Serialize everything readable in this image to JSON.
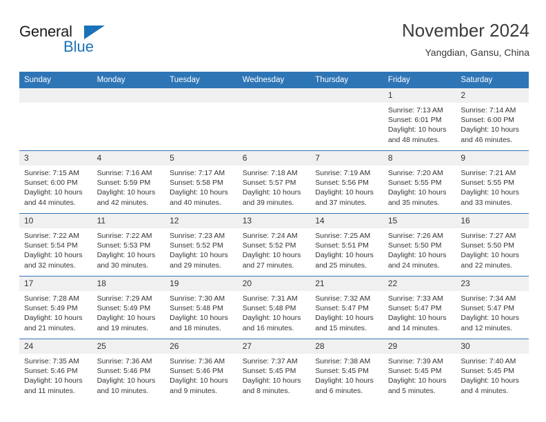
{
  "brand": {
    "name_top": "General",
    "name_bottom": "Blue",
    "accent_color": "#1b72b8"
  },
  "header": {
    "month_title": "November 2024",
    "location": "Yangdian, Gansu, China"
  },
  "theme": {
    "header_bg": "#2e75b6",
    "daynum_bg": "#f0f0f0",
    "text_color": "#333333"
  },
  "weekday_headers": [
    "Sunday",
    "Monday",
    "Tuesday",
    "Wednesday",
    "Thursday",
    "Friday",
    "Saturday"
  ],
  "weeks": [
    [
      {
        "day": "",
        "empty": true
      },
      {
        "day": "",
        "empty": true
      },
      {
        "day": "",
        "empty": true
      },
      {
        "day": "",
        "empty": true
      },
      {
        "day": "",
        "empty": true
      },
      {
        "day": "1",
        "sunrise": "Sunrise: 7:13 AM",
        "sunset": "Sunset: 6:01 PM",
        "daylight": "Daylight: 10 hours and 48 minutes."
      },
      {
        "day": "2",
        "sunrise": "Sunrise: 7:14 AM",
        "sunset": "Sunset: 6:00 PM",
        "daylight": "Daylight: 10 hours and 46 minutes."
      }
    ],
    [
      {
        "day": "3",
        "sunrise": "Sunrise: 7:15 AM",
        "sunset": "Sunset: 6:00 PM",
        "daylight": "Daylight: 10 hours and 44 minutes."
      },
      {
        "day": "4",
        "sunrise": "Sunrise: 7:16 AM",
        "sunset": "Sunset: 5:59 PM",
        "daylight": "Daylight: 10 hours and 42 minutes."
      },
      {
        "day": "5",
        "sunrise": "Sunrise: 7:17 AM",
        "sunset": "Sunset: 5:58 PM",
        "daylight": "Daylight: 10 hours and 40 minutes."
      },
      {
        "day": "6",
        "sunrise": "Sunrise: 7:18 AM",
        "sunset": "Sunset: 5:57 PM",
        "daylight": "Daylight: 10 hours and 39 minutes."
      },
      {
        "day": "7",
        "sunrise": "Sunrise: 7:19 AM",
        "sunset": "Sunset: 5:56 PM",
        "daylight": "Daylight: 10 hours and 37 minutes."
      },
      {
        "day": "8",
        "sunrise": "Sunrise: 7:20 AM",
        "sunset": "Sunset: 5:55 PM",
        "daylight": "Daylight: 10 hours and 35 minutes."
      },
      {
        "day": "9",
        "sunrise": "Sunrise: 7:21 AM",
        "sunset": "Sunset: 5:55 PM",
        "daylight": "Daylight: 10 hours and 33 minutes."
      }
    ],
    [
      {
        "day": "10",
        "sunrise": "Sunrise: 7:22 AM",
        "sunset": "Sunset: 5:54 PM",
        "daylight": "Daylight: 10 hours and 32 minutes."
      },
      {
        "day": "11",
        "sunrise": "Sunrise: 7:22 AM",
        "sunset": "Sunset: 5:53 PM",
        "daylight": "Daylight: 10 hours and 30 minutes."
      },
      {
        "day": "12",
        "sunrise": "Sunrise: 7:23 AM",
        "sunset": "Sunset: 5:52 PM",
        "daylight": "Daylight: 10 hours and 29 minutes."
      },
      {
        "day": "13",
        "sunrise": "Sunrise: 7:24 AM",
        "sunset": "Sunset: 5:52 PM",
        "daylight": "Daylight: 10 hours and 27 minutes."
      },
      {
        "day": "14",
        "sunrise": "Sunrise: 7:25 AM",
        "sunset": "Sunset: 5:51 PM",
        "daylight": "Daylight: 10 hours and 25 minutes."
      },
      {
        "day": "15",
        "sunrise": "Sunrise: 7:26 AM",
        "sunset": "Sunset: 5:50 PM",
        "daylight": "Daylight: 10 hours and 24 minutes."
      },
      {
        "day": "16",
        "sunrise": "Sunrise: 7:27 AM",
        "sunset": "Sunset: 5:50 PM",
        "daylight": "Daylight: 10 hours and 22 minutes."
      }
    ],
    [
      {
        "day": "17",
        "sunrise": "Sunrise: 7:28 AM",
        "sunset": "Sunset: 5:49 PM",
        "daylight": "Daylight: 10 hours and 21 minutes."
      },
      {
        "day": "18",
        "sunrise": "Sunrise: 7:29 AM",
        "sunset": "Sunset: 5:49 PM",
        "daylight": "Daylight: 10 hours and 19 minutes."
      },
      {
        "day": "19",
        "sunrise": "Sunrise: 7:30 AM",
        "sunset": "Sunset: 5:48 PM",
        "daylight": "Daylight: 10 hours and 18 minutes."
      },
      {
        "day": "20",
        "sunrise": "Sunrise: 7:31 AM",
        "sunset": "Sunset: 5:48 PM",
        "daylight": "Daylight: 10 hours and 16 minutes."
      },
      {
        "day": "21",
        "sunrise": "Sunrise: 7:32 AM",
        "sunset": "Sunset: 5:47 PM",
        "daylight": "Daylight: 10 hours and 15 minutes."
      },
      {
        "day": "22",
        "sunrise": "Sunrise: 7:33 AM",
        "sunset": "Sunset: 5:47 PM",
        "daylight": "Daylight: 10 hours and 14 minutes."
      },
      {
        "day": "23",
        "sunrise": "Sunrise: 7:34 AM",
        "sunset": "Sunset: 5:47 PM",
        "daylight": "Daylight: 10 hours and 12 minutes."
      }
    ],
    [
      {
        "day": "24",
        "sunrise": "Sunrise: 7:35 AM",
        "sunset": "Sunset: 5:46 PM",
        "daylight": "Daylight: 10 hours and 11 minutes."
      },
      {
        "day": "25",
        "sunrise": "Sunrise: 7:36 AM",
        "sunset": "Sunset: 5:46 PM",
        "daylight": "Daylight: 10 hours and 10 minutes."
      },
      {
        "day": "26",
        "sunrise": "Sunrise: 7:36 AM",
        "sunset": "Sunset: 5:46 PM",
        "daylight": "Daylight: 10 hours and 9 minutes."
      },
      {
        "day": "27",
        "sunrise": "Sunrise: 7:37 AM",
        "sunset": "Sunset: 5:45 PM",
        "daylight": "Daylight: 10 hours and 8 minutes."
      },
      {
        "day": "28",
        "sunrise": "Sunrise: 7:38 AM",
        "sunset": "Sunset: 5:45 PM",
        "daylight": "Daylight: 10 hours and 6 minutes."
      },
      {
        "day": "29",
        "sunrise": "Sunrise: 7:39 AM",
        "sunset": "Sunset: 5:45 PM",
        "daylight": "Daylight: 10 hours and 5 minutes."
      },
      {
        "day": "30",
        "sunrise": "Sunrise: 7:40 AM",
        "sunset": "Sunset: 5:45 PM",
        "daylight": "Daylight: 10 hours and 4 minutes."
      }
    ]
  ]
}
